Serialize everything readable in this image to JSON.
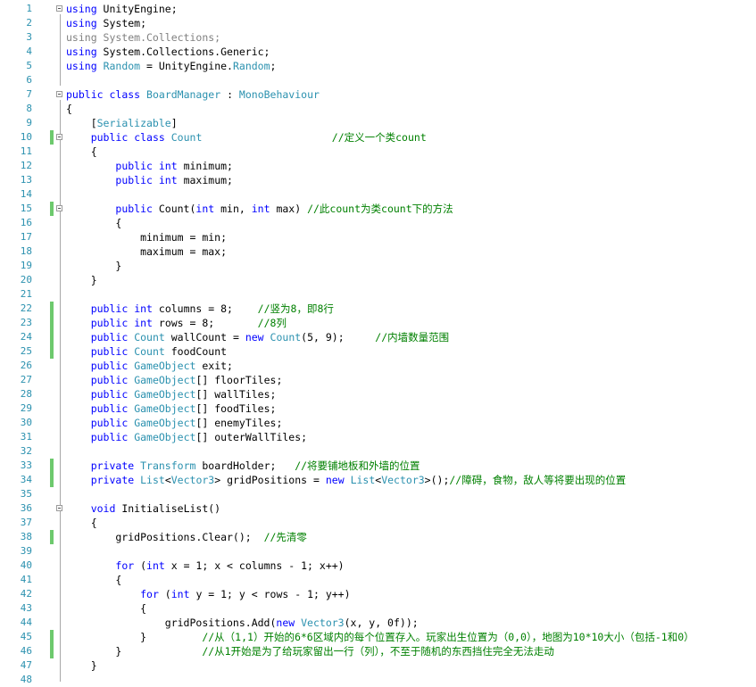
{
  "colors": {
    "keyword": "#0000ff",
    "type": "#2b91af",
    "comment": "#008000",
    "grey": "#808080",
    "line_number": "#2b91af",
    "changed_marker": "#6dc96d"
  },
  "editor": {
    "lines": [
      {
        "n": "1",
        "fold": true,
        "code": [
          [
            "kw",
            "using"
          ],
          [
            "tx",
            " UnityEngine;"
          ]
        ]
      },
      {
        "n": "2",
        "code": [
          [
            "kw",
            "using"
          ],
          [
            "tx",
            " System;"
          ]
        ]
      },
      {
        "n": "3",
        "code": [
          [
            "gr",
            "using System.Collections;"
          ]
        ]
      },
      {
        "n": "4",
        "code": [
          [
            "kw",
            "using"
          ],
          [
            "tx",
            " System.Collections.Generic;"
          ]
        ]
      },
      {
        "n": "5",
        "code": [
          [
            "kw",
            "using"
          ],
          [
            "tx",
            " "
          ],
          [
            "ty",
            "Random"
          ],
          [
            "tx",
            " = UnityEngine."
          ],
          [
            "ty",
            "Random"
          ],
          [
            "tx",
            ";"
          ]
        ]
      },
      {
        "n": "6",
        "code": []
      },
      {
        "n": "7",
        "fold": true,
        "code": [
          [
            "kw",
            "public"
          ],
          [
            "tx",
            " "
          ],
          [
            "kw",
            "class"
          ],
          [
            "tx",
            " "
          ],
          [
            "ty",
            "BoardManager"
          ],
          [
            "tx",
            " : "
          ],
          [
            "ty",
            "MonoBehaviour"
          ]
        ]
      },
      {
        "n": "8",
        "code": [
          [
            "tx",
            "{"
          ]
        ]
      },
      {
        "n": "9",
        "code": [
          [
            "tx",
            "    ["
          ],
          [
            "ty",
            "Serializable"
          ],
          [
            "tx",
            "]"
          ]
        ]
      },
      {
        "n": "10",
        "fold": true,
        "changed": true,
        "code": [
          [
            "tx",
            "    "
          ],
          [
            "kw",
            "public"
          ],
          [
            "tx",
            " "
          ],
          [
            "kw",
            "class"
          ],
          [
            "tx",
            " "
          ],
          [
            "ty",
            "Count"
          ],
          [
            "tx",
            "                     "
          ],
          [
            "cm",
            "//定义一个类count"
          ]
        ]
      },
      {
        "n": "11",
        "code": [
          [
            "tx",
            "    {"
          ]
        ]
      },
      {
        "n": "12",
        "code": [
          [
            "tx",
            "        "
          ],
          [
            "kw",
            "public"
          ],
          [
            "tx",
            " "
          ],
          [
            "kw",
            "int"
          ],
          [
            "tx",
            " minimum;"
          ]
        ]
      },
      {
        "n": "13",
        "code": [
          [
            "tx",
            "        "
          ],
          [
            "kw",
            "public"
          ],
          [
            "tx",
            " "
          ],
          [
            "kw",
            "int"
          ],
          [
            "tx",
            " maximum;"
          ]
        ]
      },
      {
        "n": "14",
        "code": []
      },
      {
        "n": "15",
        "fold": true,
        "changed": true,
        "code": [
          [
            "tx",
            "        "
          ],
          [
            "kw",
            "public"
          ],
          [
            "tx",
            " Count("
          ],
          [
            "kw",
            "int"
          ],
          [
            "tx",
            " min, "
          ],
          [
            "kw",
            "int"
          ],
          [
            "tx",
            " max) "
          ],
          [
            "cm",
            "//此count为类count下的方法"
          ]
        ]
      },
      {
        "n": "16",
        "code": [
          [
            "tx",
            "        {"
          ]
        ]
      },
      {
        "n": "17",
        "code": [
          [
            "tx",
            "            minimum = min;"
          ]
        ]
      },
      {
        "n": "18",
        "code": [
          [
            "tx",
            "            maximum = max;"
          ]
        ]
      },
      {
        "n": "19",
        "code": [
          [
            "tx",
            "        }"
          ]
        ]
      },
      {
        "n": "20",
        "code": [
          [
            "tx",
            "    }"
          ]
        ]
      },
      {
        "n": "21",
        "code": []
      },
      {
        "n": "22",
        "changed": true,
        "code": [
          [
            "tx",
            "    "
          ],
          [
            "kw",
            "public"
          ],
          [
            "tx",
            " "
          ],
          [
            "kw",
            "int"
          ],
          [
            "tx",
            " columns = 8;    "
          ],
          [
            "cm",
            "//竖为8，即8行"
          ]
        ]
      },
      {
        "n": "23",
        "changed": true,
        "code": [
          [
            "tx",
            "    "
          ],
          [
            "kw",
            "public"
          ],
          [
            "tx",
            " "
          ],
          [
            "kw",
            "int"
          ],
          [
            "tx",
            " rows = 8;       "
          ],
          [
            "cm",
            "//8列"
          ]
        ]
      },
      {
        "n": "24",
        "changed": true,
        "code": [
          [
            "tx",
            "    "
          ],
          [
            "kw",
            "public"
          ],
          [
            "tx",
            " "
          ],
          [
            "ty",
            "Count"
          ],
          [
            "tx",
            " wallCount = "
          ],
          [
            "kw",
            "new"
          ],
          [
            "tx",
            " "
          ],
          [
            "ty",
            "Count"
          ],
          [
            "tx",
            "(5, 9);     "
          ],
          [
            "cm",
            "//内墙数量范围"
          ]
        ]
      },
      {
        "n": "25",
        "changed": true,
        "code": [
          [
            "tx",
            "    "
          ],
          [
            "kw",
            "public"
          ],
          [
            "tx",
            " "
          ],
          [
            "ty",
            "Count"
          ],
          [
            "tx",
            " foodCount "
          ]
        ]
      },
      {
        "n": "26",
        "code": [
          [
            "tx",
            "    "
          ],
          [
            "kw",
            "public"
          ],
          [
            "tx",
            " "
          ],
          [
            "ty",
            "GameObject"
          ],
          [
            "tx",
            " exit;"
          ]
        ]
      },
      {
        "n": "27",
        "code": [
          [
            "tx",
            "    "
          ],
          [
            "kw",
            "public"
          ],
          [
            "tx",
            " "
          ],
          [
            "ty",
            "GameObject"
          ],
          [
            "tx",
            "[] floorTiles;"
          ]
        ]
      },
      {
        "n": "28",
        "code": [
          [
            "tx",
            "    "
          ],
          [
            "kw",
            "public"
          ],
          [
            "tx",
            " "
          ],
          [
            "ty",
            "GameObject"
          ],
          [
            "tx",
            "[] wallTiles;"
          ]
        ]
      },
      {
        "n": "29",
        "code": [
          [
            "tx",
            "    "
          ],
          [
            "kw",
            "public"
          ],
          [
            "tx",
            " "
          ],
          [
            "ty",
            "GameObject"
          ],
          [
            "tx",
            "[] foodTiles;"
          ]
        ]
      },
      {
        "n": "30",
        "code": [
          [
            "tx",
            "    "
          ],
          [
            "kw",
            "public"
          ],
          [
            "tx",
            " "
          ],
          [
            "ty",
            "GameObject"
          ],
          [
            "tx",
            "[] enemyTiles;"
          ]
        ]
      },
      {
        "n": "31",
        "code": [
          [
            "tx",
            "    "
          ],
          [
            "kw",
            "public"
          ],
          [
            "tx",
            " "
          ],
          [
            "ty",
            "GameObject"
          ],
          [
            "tx",
            "[] outerWallTiles;"
          ]
        ]
      },
      {
        "n": "32",
        "code": []
      },
      {
        "n": "33",
        "changed": true,
        "code": [
          [
            "tx",
            "    "
          ],
          [
            "kw",
            "private"
          ],
          [
            "tx",
            " "
          ],
          [
            "ty",
            "Transform"
          ],
          [
            "tx",
            " boardHolder;   "
          ],
          [
            "cm",
            "//将要铺地板和外墙的位置"
          ]
        ]
      },
      {
        "n": "34",
        "changed": true,
        "code": [
          [
            "tx",
            "    "
          ],
          [
            "kw",
            "private"
          ],
          [
            "tx",
            " "
          ],
          [
            "ty",
            "List"
          ],
          [
            "tx",
            "<"
          ],
          [
            "ty",
            "Vector3"
          ],
          [
            "tx",
            "> gridPositions = "
          ],
          [
            "kw",
            "new"
          ],
          [
            "tx",
            " "
          ],
          [
            "ty",
            "List"
          ],
          [
            "tx",
            "<"
          ],
          [
            "ty",
            "Vector3"
          ],
          [
            "tx",
            ">();"
          ],
          [
            "cm",
            "//障碍，食物，敌人等将要出现的位置"
          ]
        ]
      },
      {
        "n": "35",
        "code": []
      },
      {
        "n": "36",
        "fold": true,
        "code": [
          [
            "tx",
            "    "
          ],
          [
            "kw",
            "void"
          ],
          [
            "tx",
            " InitialiseList()"
          ]
        ]
      },
      {
        "n": "37",
        "code": [
          [
            "tx",
            "    {"
          ]
        ]
      },
      {
        "n": "38",
        "changed": true,
        "code": [
          [
            "tx",
            "        gridPositions.Clear();  "
          ],
          [
            "cm",
            "//先清零"
          ]
        ]
      },
      {
        "n": "39",
        "code": []
      },
      {
        "n": "40",
        "code": [
          [
            "tx",
            "        "
          ],
          [
            "kw",
            "for"
          ],
          [
            "tx",
            " ("
          ],
          [
            "kw",
            "int"
          ],
          [
            "tx",
            " x = 1; x < columns - 1; x++)"
          ]
        ]
      },
      {
        "n": "41",
        "code": [
          [
            "tx",
            "        {"
          ]
        ]
      },
      {
        "n": "42",
        "code": [
          [
            "tx",
            "            "
          ],
          [
            "kw",
            "for"
          ],
          [
            "tx",
            " ("
          ],
          [
            "kw",
            "int"
          ],
          [
            "tx",
            " y = 1; y < rows - 1; y++)"
          ]
        ]
      },
      {
        "n": "43",
        "code": [
          [
            "tx",
            "            {"
          ]
        ]
      },
      {
        "n": "44",
        "code": [
          [
            "tx",
            "                gridPositions.Add("
          ],
          [
            "kw",
            "new"
          ],
          [
            "tx",
            " "
          ],
          [
            "ty",
            "Vector3"
          ],
          [
            "tx",
            "(x, y, 0f));"
          ]
        ]
      },
      {
        "n": "45",
        "changed": true,
        "code": [
          [
            "tx",
            "            }         "
          ],
          [
            "cm",
            "//从（1,1）开始的6*6区域内的每个位置存入。玩家出生位置为（0,0），地图为10*10大小（包括-1和0）"
          ]
        ]
      },
      {
        "n": "46",
        "changed": true,
        "code": [
          [
            "tx",
            "        }             "
          ],
          [
            "cm",
            "//从1开始是为了给玩家留出一行（列），不至于随机的东西挡住完全无法走动"
          ]
        ]
      },
      {
        "n": "47",
        "code": [
          [
            "tx",
            "    }"
          ]
        ]
      },
      {
        "n": "48",
        "code": []
      }
    ]
  }
}
